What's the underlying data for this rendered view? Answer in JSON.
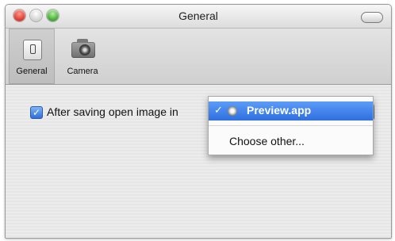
{
  "window": {
    "title": "General"
  },
  "toolbar": {
    "items": [
      {
        "label": "General",
        "icon": "switch-icon",
        "selected": true
      },
      {
        "label": "Camera",
        "icon": "camera-icon",
        "selected": false
      }
    ]
  },
  "content": {
    "checkbox_label": "After saving open image in",
    "checkbox_checked": true
  },
  "popup_menu": {
    "items": [
      {
        "label": "Preview.app",
        "checked": true,
        "icon": "app-icon"
      },
      {
        "label": "Choose other..."
      }
    ],
    "selected_color": "#2f6fe0"
  }
}
